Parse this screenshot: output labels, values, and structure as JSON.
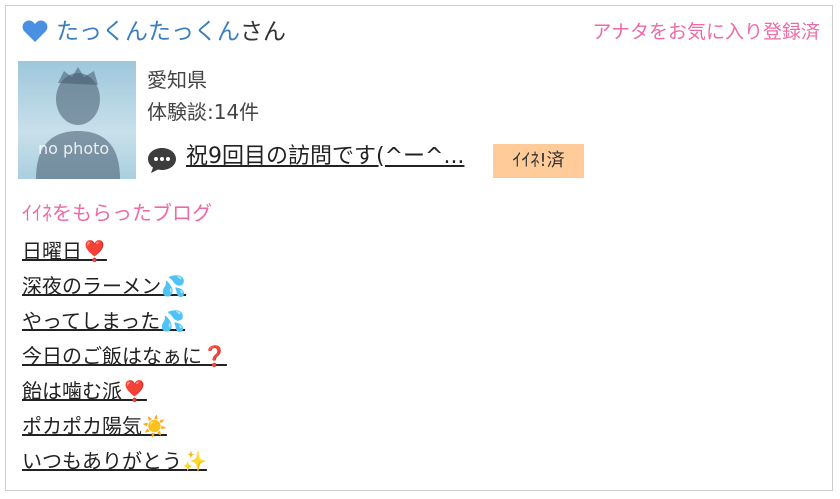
{
  "header": {
    "nickname": "たっくんたっくん",
    "suffix": "さん",
    "favorite_status": "アナタをお気に入り登録済",
    "heart_color": "#4a90e2"
  },
  "profile": {
    "photo_placeholder": "no photo",
    "prefecture": "愛知県",
    "reviews": "体験談:14件"
  },
  "visit": {
    "message": "祝9回目の訪問です(^ー^...",
    "iine_badge": "ｲｲﾈ!済"
  },
  "blog": {
    "heading": "ｲｲﾈをもらったブログ",
    "items": [
      {
        "title": "日曜日❣️"
      },
      {
        "title": "深夜のラーメン💦"
      },
      {
        "title": "やってしまった💦"
      },
      {
        "title": "今日のご飯はなぁに❓"
      },
      {
        "title": "飴は噛む派❣️"
      },
      {
        "title": "ポカポカ陽気☀️"
      },
      {
        "title": "いつもありがとう✨"
      }
    ]
  },
  "colors": {
    "accent_pink": "#ee6aa7",
    "link_blue": "#3a7fc1",
    "badge_bg": "#ffcc99"
  }
}
